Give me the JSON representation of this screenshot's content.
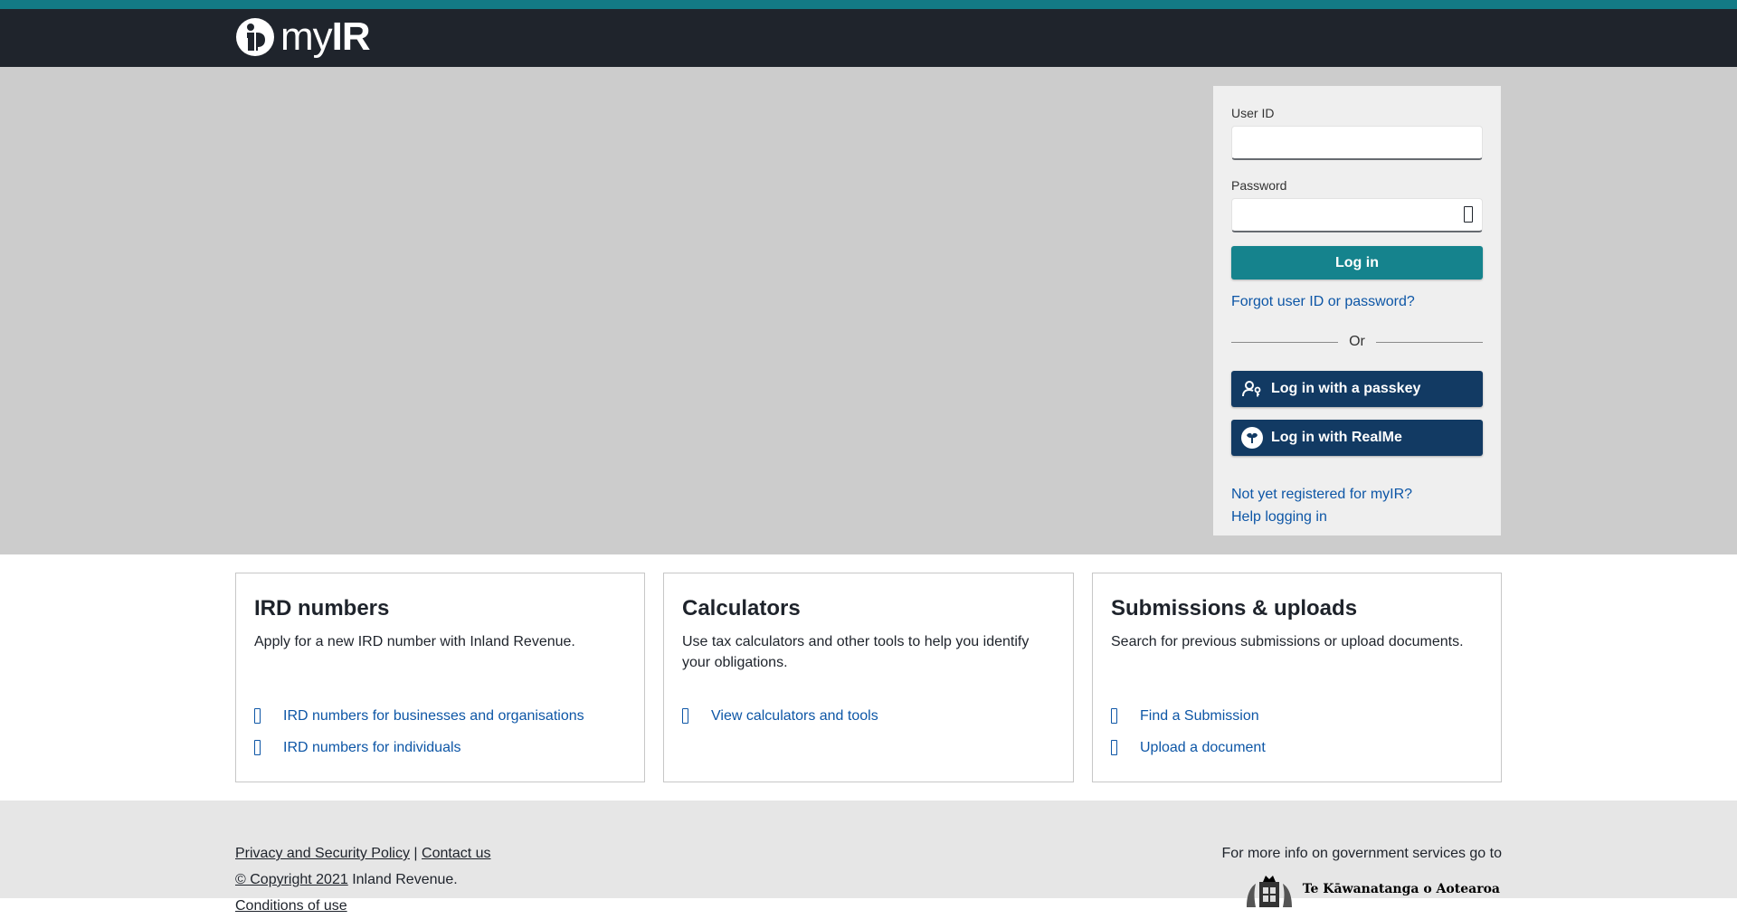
{
  "header": {
    "logo_prefix": "my",
    "logo_bold": "IR"
  },
  "login": {
    "user_id_label": "User ID",
    "user_id_value": "",
    "password_label": "Password",
    "password_value": "",
    "login_button": "Log in",
    "forgot_link": "Forgot user ID or password?",
    "or_text": "Or",
    "passkey_button": "Log in with a passkey",
    "realme_button": "Log in with RealMe",
    "register_link": "Not yet registered for myIR?",
    "help_link": "Help logging in"
  },
  "cards": [
    {
      "title": "IRD numbers",
      "description": "Apply for a new IRD number with Inland Revenue.",
      "links": [
        "IRD numbers for businesses and organisations",
        "IRD numbers for individuals"
      ]
    },
    {
      "title": "Calculators",
      "description": "Use tax calculators and other tools to help you identify your obligations.",
      "links": [
        "View calculators and tools"
      ]
    },
    {
      "title": "Submissions & uploads",
      "description": "Search for previous submissions or upload documents.",
      "links": [
        "Find a Submission",
        "Upload a document"
      ]
    }
  ],
  "footer": {
    "privacy_link": "Privacy and Security Policy",
    "separator": "|",
    "contact_link": "Contact us",
    "copyright_link": "© Copyright 2021",
    "copyright_org": "Inland Revenue.",
    "conditions_partial": "Conditions of use",
    "govt_info": "For more info on government services go to",
    "govt_logo_text": "Te Kāwanatanga o Aotearoa"
  },
  "colors": {
    "header_bg": "#1f242c",
    "accent_teal": "#15838d",
    "dark_blue_button": "#123a63",
    "link_blue": "#0d56a6",
    "hero_bg": "#cccccc"
  },
  "icons": {
    "logo": "myir-logo-icon",
    "password_toggle": "eye-icon",
    "passkey": "person-key-icon",
    "realme": "realme-icon",
    "link_arrow": "arrow-right-icon",
    "govt_crest": "nz-coat-of-arms-icon"
  }
}
